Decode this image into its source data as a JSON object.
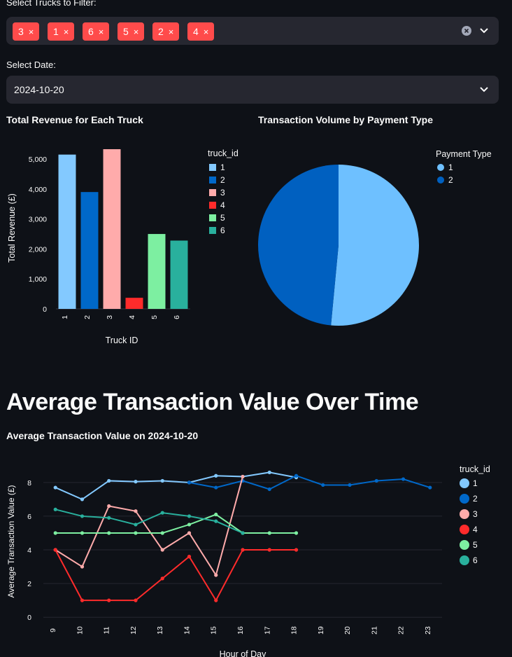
{
  "filters": {
    "trucks_label": "Select Trucks to Filter:",
    "selected_trucks": [
      "3",
      "1",
      "6",
      "5",
      "2",
      "4"
    ],
    "chip_close": "×",
    "date_label": "Select Date:",
    "date_value": "2024-10-20"
  },
  "charts_titles": {
    "revenue": "Total Revenue for Each Truck",
    "payment": "Transaction Volume by Payment Type",
    "section": "Average Transaction Value Over Time",
    "line": "Average Transaction Value on 2024-10-20"
  },
  "colors": {
    "accent": "#ff4b4b",
    "t1": "#83c9ff",
    "t2": "#0068c9",
    "t3": "#ffabab",
    "t4": "#ff2b2b",
    "t5": "#7defa1",
    "t6": "#29b09d",
    "pie1": "#6ec0ff",
    "pie2": "#0060c0"
  },
  "chart_data": [
    {
      "type": "bar",
      "title": "Total Revenue for Each Truck",
      "xlabel": "Truck ID",
      "ylabel": "Total Revenue (£)",
      "categories": [
        "1",
        "2",
        "3",
        "4",
        "5",
        "6"
      ],
      "values": [
        5150,
        3900,
        5330,
        370,
        2500,
        2280
      ],
      "ylim": [
        0,
        5400
      ],
      "yticks": [
        0,
        1000,
        2000,
        3000,
        4000,
        5000
      ],
      "ytick_labels": [
        "0",
        "1,000",
        "2,000",
        "3,000",
        "4,000",
        "5,000"
      ],
      "legend_title": "truck_id",
      "legend": [
        "1",
        "2",
        "3",
        "4",
        "5",
        "6"
      ]
    },
    {
      "type": "pie",
      "title": "Transaction Volume by Payment Type",
      "legend_title": "Payment Type",
      "labels": [
        "1",
        "2"
      ],
      "values": [
        51.5,
        48.5
      ]
    },
    {
      "type": "line",
      "title": "Average Transaction Value on 2024-10-20",
      "xlabel": "Hour of Day",
      "ylabel": "Average Transaction Value (£)",
      "xlim": [
        8.55,
        23.45
      ],
      "ylim": [
        -0.2,
        9.2
      ],
      "xticks": [
        9,
        10,
        11,
        12,
        13,
        14,
        15,
        16,
        17,
        18,
        19,
        20,
        21,
        22,
        23
      ],
      "yticks": [
        0,
        2,
        4,
        6,
        8
      ],
      "legend_title": "truck_id",
      "series": [
        {
          "name": "1",
          "x": [
            9,
            10,
            11,
            12,
            13,
            14,
            15,
            16,
            17,
            18
          ],
          "y": [
            7.7,
            7.0,
            8.1,
            8.05,
            8.1,
            8.0,
            8.4,
            8.35,
            8.6,
            8.3
          ]
        },
        {
          "name": "2",
          "x": [
            14,
            15,
            16,
            17,
            18,
            19,
            20,
            21,
            22,
            23
          ],
          "y": [
            8.0,
            7.7,
            8.1,
            7.6,
            8.4,
            7.85,
            7.85,
            8.1,
            8.2,
            7.7
          ]
        },
        {
          "name": "3",
          "x": [
            9,
            10,
            11,
            12,
            13,
            14,
            15,
            16
          ],
          "y": [
            4.0,
            3.0,
            6.6,
            6.3,
            4.0,
            5.0,
            2.5,
            8.35
          ]
        },
        {
          "name": "4",
          "x": [
            9,
            10,
            11,
            12,
            13,
            14,
            15,
            16,
            17,
            18
          ],
          "y": [
            4.0,
            1.0,
            1.0,
            1.0,
            2.3,
            3.6,
            1.0,
            4.0,
            4.0,
            4.0
          ]
        },
        {
          "name": "5",
          "x": [
            9,
            10,
            11,
            12,
            13,
            14,
            15,
            16,
            17,
            18
          ],
          "y": [
            5.0,
            5.0,
            5.0,
            5.0,
            5.0,
            5.5,
            6.1,
            5.0,
            5.0,
            5.0
          ]
        },
        {
          "name": "6",
          "x": [
            9,
            10,
            11,
            12,
            13,
            14,
            15,
            16
          ],
          "y": [
            6.4,
            6.0,
            5.9,
            5.5,
            6.2,
            6.0,
            5.7,
            5.0
          ]
        }
      ]
    }
  ]
}
